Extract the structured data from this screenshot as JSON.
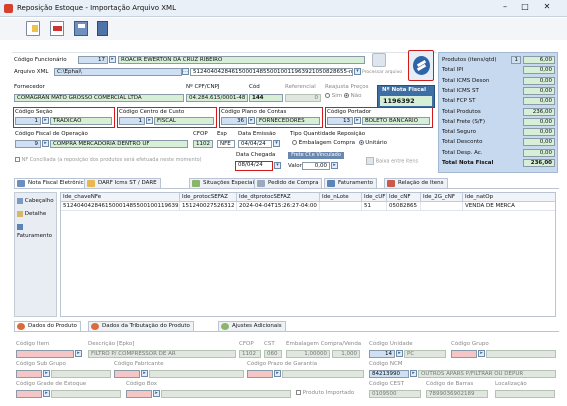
{
  "window": {
    "title": "Reposição Estoque - Importação Arquivo XML"
  },
  "header": {
    "funcionario_label": "Código Funcionário",
    "funcionario_code": "17",
    "funcionario_name": "ROACIR EWERTON DA CRUZ RIBEIRO",
    "xml_label": "Arquivo XML",
    "xml_path": "C:\\Ephai\\",
    "xml_key": "51240404284615000148550010011963921050828655-nfe.x",
    "processar_label": "Processar arquivo",
    "fornecedor_label": "Fornecedor",
    "fornecedor_name": "COMAGRAN MATO GROSSO COMERCIAL LTDA",
    "cnpj_label": "Nº CPF/CNPJ",
    "cnpj": "04.284.615/0001-48",
    "cod_label": "Cód",
    "cod": "144",
    "referencia_label": "Referencial",
    "referencia": "0",
    "reajusta_label": "Reajusta Preços",
    "sim": "Sim",
    "nao": "Não",
    "nota_label": "Nº Nota Fiscal",
    "nota": "1196392",
    "secao_label": "Código Seção",
    "secao_code": "1",
    "secao_name": "TRADICAO",
    "centro_label": "Código Centro de Custo",
    "centro_code": "1",
    "centro_name": "FISCAL",
    "plano_label": "Código Plano de Contas",
    "plano_code": "36",
    "plano_name": "FORNECEDORES",
    "portador_label": "Código Portador",
    "portador_code": "13",
    "portador_name": "BOLETO BANCARIO",
    "operacao_label": "Código Fiscal de Operação",
    "operacao_code": "9",
    "operacao_name": "COMPRA MERCADORIA DENTRO UF",
    "cfop_label": "CFOP",
    "cfop": "1102",
    "esp_label": "Esp",
    "esp": "NFE",
    "emissao_label": "Data Emissão",
    "emissao": "04/04/24",
    "tipo_label": "Tipo Quantidade Reposição",
    "embalagem": "Embalagem Compra",
    "unitario": "Unitário",
    "nf_conciliada": "NF Conciliada (a reposição dos produtos será efetuada neste momento)",
    "chegada_label": "Data Chegada",
    "chegada": "08/04/24",
    "frete_label": "Frete Cf.e Vinculado",
    "valor_label": "Valor",
    "valor": "0,00",
    "baixa_label": "Baixa entre itens"
  },
  "totals": {
    "labels": [
      "Produtos (itens/qtd)",
      "Total IPI",
      "Total ICMS Deson",
      "Total ICMS ST",
      "Total FCP ST",
      "Total Produtos",
      "Total Frete (S/F)",
      "Total Seguro",
      "Total Desconto",
      "Total Desp. Ac.",
      "Total Nota Fiscal"
    ],
    "values": [
      "6,00",
      "0,00",
      "0,00",
      "0,00",
      "0,00",
      "236,00",
      "0,00",
      "0,00",
      "0,00",
      "0,00",
      "236,00"
    ],
    "items_count": "1"
  },
  "tabs": [
    "Nota Fiscal Eletrônica",
    "DARF Icms ST / DARE",
    "Situações Especiais",
    "Pedido de Compra",
    "Faturamento",
    "Relação de Itens"
  ],
  "side_items": [
    "Cabeçalho",
    "Detalhe",
    "Faturamento"
  ],
  "table": {
    "headers": [
      "Ide_chaveNFe",
      "Ide_protocSEFAZ",
      "Ide_dtprotocSEFAZ",
      "Ide_nLote",
      "Ide_cUF",
      "Ide_cNF",
      "Ide_2G_cNF",
      "Ide_natOp"
    ],
    "row": [
      "51240404284615000148550010011963921050828655",
      "151240027526312",
      "2024-04-04T15:26:27-04:00",
      "",
      "51",
      "05082865",
      "",
      "VENDA DE MERCA"
    ]
  },
  "bottom": {
    "tabs": [
      "Dados do Produto",
      "Dados da Tributação do Produto",
      "Ajustes Adicionais"
    ],
    "codigo_item_label": "Código Item",
    "descricao_label": "Descrição [Epko]",
    "descricao": "FILTRO P/ COMPRESSOR DE AR",
    "cfop_label": "CFOP",
    "cfop": "1102",
    "cst_label": "CST",
    "cst": "060",
    "emb_label": "Embalagem Compra/Venda",
    "emb_compra": "1,00000",
    "emb_venda": "1,000",
    "unidade_label": "Código Unidade",
    "unidade_code": "14",
    "unidade": "PC",
    "grupo_label": "Código Grupo",
    "subgrupo_label": "Código Sub Grupo",
    "fabricante_label": "Código Fabricante",
    "prazo_label": "Código Prazo de Garantia",
    "ncm_label": "Código NCM",
    "ncm_code": "84213990",
    "ncm_desc": "OUTROS APARS P/FILTRAR OU DEPUR",
    "grade_label": "Código Grade de Estoque",
    "box_label": "Código Box",
    "importado": "Produto Importado",
    "cest_label": "Código CEST",
    "cest": "0109500",
    "barras_label": "Código de Barras",
    "barras": "7899036902189",
    "localizacao_label": "Localização"
  },
  "colors": {
    "title_bar": "#eaf0f7",
    "green_field": "#d6efd6",
    "blue_panel": "#c7d9ef",
    "red_highlight": "#d21a1a"
  }
}
